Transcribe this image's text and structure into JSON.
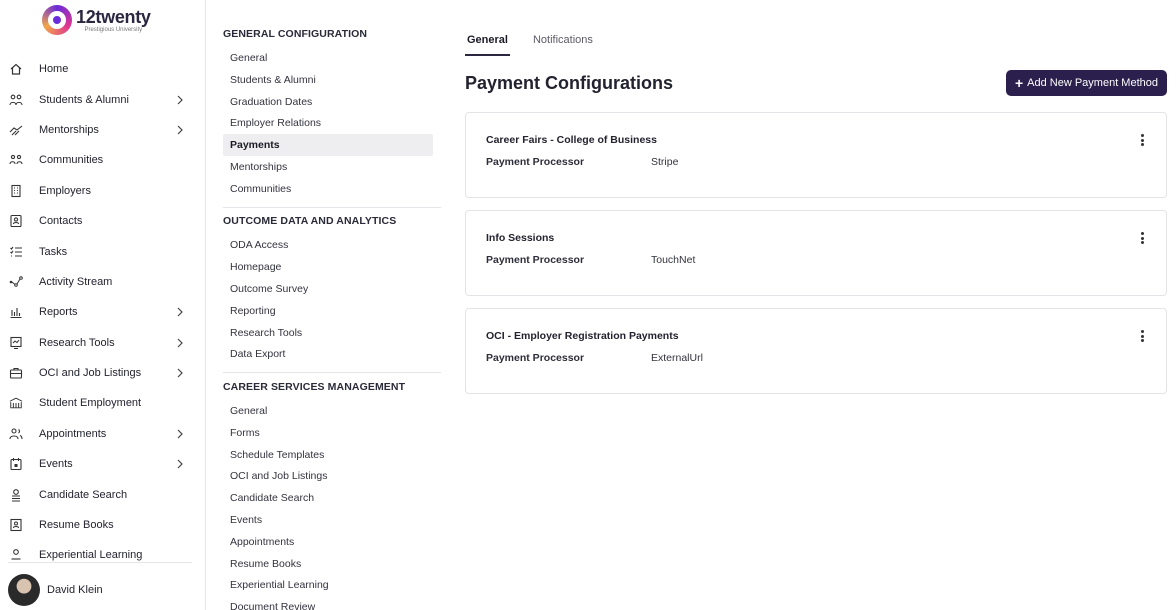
{
  "brand": {
    "name": "12twenty",
    "subtitle": "Prestigious University"
  },
  "sidebar": {
    "items": [
      {
        "label": "Home",
        "icon": "home-icon",
        "chevron": false
      },
      {
        "label": "Students & Alumni",
        "icon": "people-icon",
        "chevron": true
      },
      {
        "label": "Mentorships",
        "icon": "handshake-icon",
        "chevron": true
      },
      {
        "label": "Communities",
        "icon": "group-icon",
        "chevron": false
      },
      {
        "label": "Employers",
        "icon": "building-icon",
        "chevron": false
      },
      {
        "label": "Contacts",
        "icon": "contact-card-icon",
        "chevron": false
      },
      {
        "label": "Tasks",
        "icon": "checklist-icon",
        "chevron": false
      },
      {
        "label": "Activity Stream",
        "icon": "activity-nodes-icon",
        "chevron": false
      },
      {
        "label": "Reports",
        "icon": "bar-chart-icon",
        "chevron": true
      },
      {
        "label": "Research Tools",
        "icon": "research-icon",
        "chevron": true
      },
      {
        "label": "OCI and Job Listings",
        "icon": "briefcase-icon",
        "chevron": true
      },
      {
        "label": "Student Employment",
        "icon": "campus-building-icon",
        "chevron": false
      },
      {
        "label": "Appointments",
        "icon": "users-icon",
        "chevron": true
      },
      {
        "label": "Events",
        "icon": "calendar-icon",
        "chevron": true
      },
      {
        "label": "Candidate Search",
        "icon": "candidate-search-icon",
        "chevron": false
      },
      {
        "label": "Resume Books",
        "icon": "resume-book-icon",
        "chevron": false
      },
      {
        "label": "Experiential Learning",
        "icon": "person-icon",
        "chevron": false
      }
    ]
  },
  "user": {
    "name": "David Klein"
  },
  "settings": {
    "sections": [
      {
        "title": "GENERAL CONFIGURATION",
        "items": [
          "General",
          "Students & Alumni",
          "Graduation Dates",
          "Employer Relations",
          "Payments",
          "Mentorships",
          "Communities"
        ]
      },
      {
        "title": "OUTCOME DATA AND ANALYTICS",
        "items": [
          "ODA Access",
          "Homepage",
          "Outcome Survey",
          "Reporting",
          "Research Tools",
          "Data Export"
        ]
      },
      {
        "title": "CAREER SERVICES MANAGEMENT",
        "items": [
          "General",
          "Forms",
          "Schedule Templates",
          "OCI and Job Listings",
          "Candidate Search",
          "Events",
          "Appointments",
          "Resume Books",
          "Experiential Learning",
          "Document Review"
        ]
      }
    ],
    "active_item": "Payments"
  },
  "main": {
    "tabs": [
      {
        "label": "General",
        "active": true
      },
      {
        "label": "Notifications",
        "active": false
      }
    ],
    "title": "Payment Configurations",
    "add_button": "Add New Payment Method",
    "cards": [
      {
        "title": "Career Fairs - College of Business",
        "label": "Payment Processor",
        "value": "Stripe"
      },
      {
        "title": "Info Sessions",
        "label": "Payment Processor",
        "value": "TouchNet"
      },
      {
        "title": "OCI - Employer Registration Payments",
        "label": "Payment Processor",
        "value": "ExternalUrl"
      }
    ]
  },
  "colors": {
    "primary_button": "#2a1f4d",
    "active_bg": "#eeeef0",
    "border": "#e4e4e8"
  }
}
